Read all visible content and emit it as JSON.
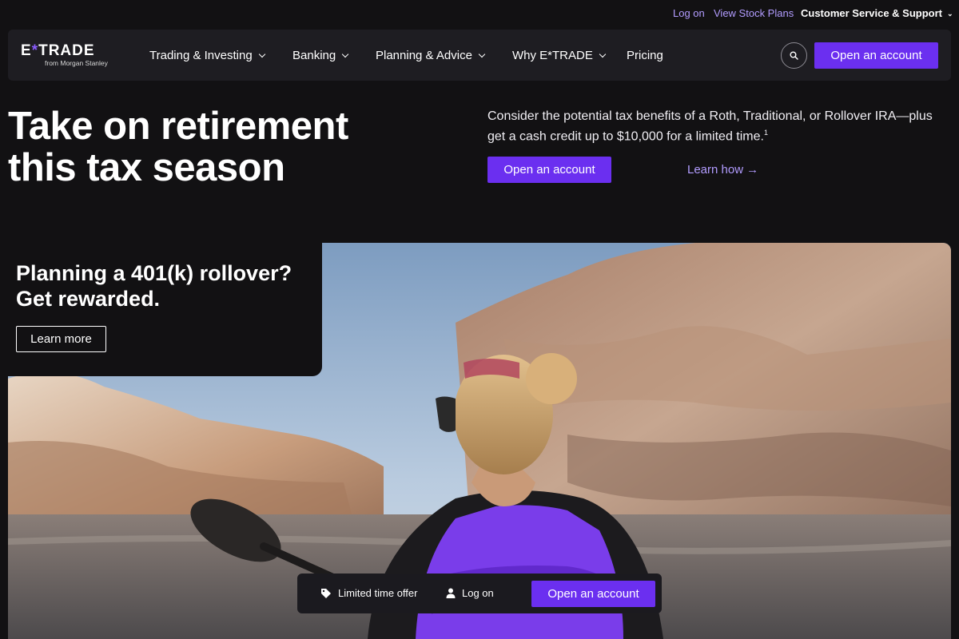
{
  "utility_nav": {
    "log_on": "Log on",
    "view_stock_plans": "View Stock Plans",
    "customer_service": "Customer Service & Support"
  },
  "brand": {
    "logo_text": "E*TRADE",
    "logo_sub": "from Morgan Stanley",
    "accent_color": "#6b2ff0",
    "link_color": "#b29cff"
  },
  "main_nav": {
    "items": [
      {
        "label": "Trading & Investing",
        "has_dropdown": true
      },
      {
        "label": "Banking",
        "has_dropdown": true
      },
      {
        "label": "Planning & Advice",
        "has_dropdown": true
      },
      {
        "label": "Why E*TRADE",
        "has_dropdown": true
      },
      {
        "label": "Pricing",
        "has_dropdown": false
      }
    ],
    "search_icon": "search-icon",
    "cta_label": "Open an account"
  },
  "hero": {
    "title": "Take on retirement this tax season",
    "description": "Consider the potential tax benefits of a Roth, Traditional, or Rollover IRA—plus get a cash credit up to $10,000 for a limited time.",
    "footnote": "1",
    "cta_label": "Open an account",
    "secondary_link": "Learn how"
  },
  "promo": {
    "title": "Planning a 401(k) rollover? Get rewarded.",
    "button_label": "Learn more"
  },
  "sticky_bar": {
    "offer_label": "Limited time offer",
    "offer_icon": "tag-icon",
    "log_on_label": "Log on",
    "log_on_icon": "user-icon",
    "cta_label": "Open an account"
  }
}
